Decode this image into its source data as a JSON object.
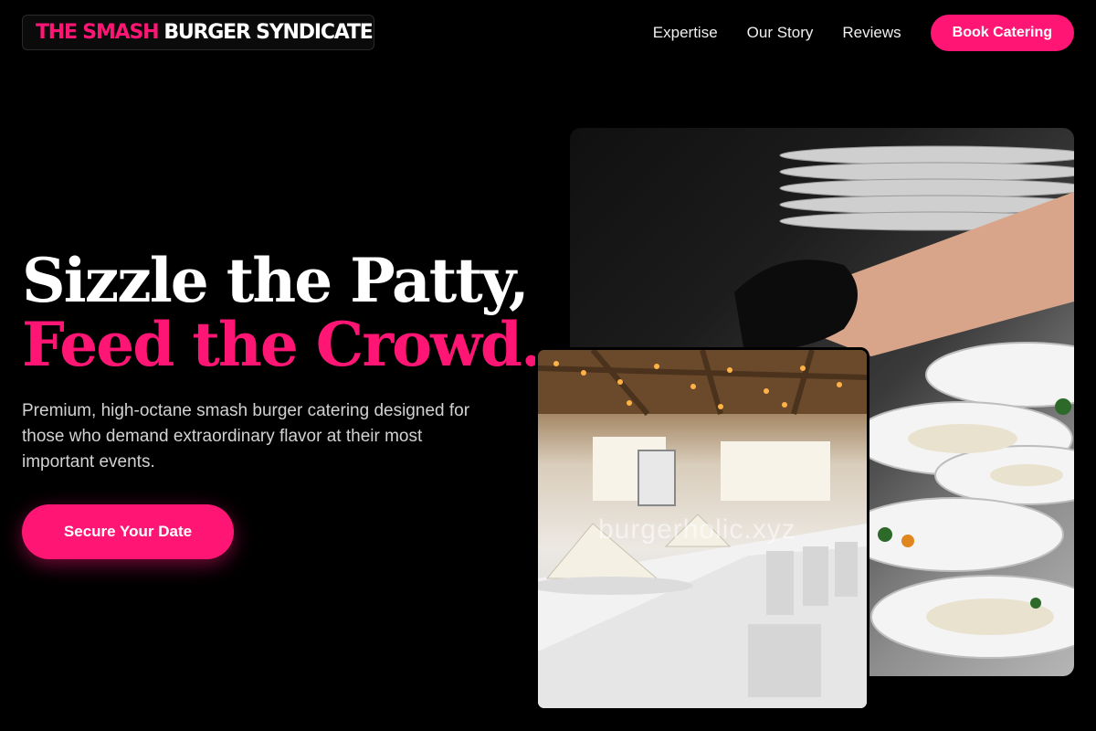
{
  "header": {
    "logo_accent": "THE SMASH",
    "logo_main": "BURGER SYNDICATE",
    "nav": [
      {
        "label": "Expertise"
      },
      {
        "label": "Our Story"
      },
      {
        "label": "Reviews"
      }
    ],
    "cta_label": "Book Catering"
  },
  "hero": {
    "headline_line1": "Sizzle the Patty,",
    "headline_line2": "Feed the Crowd.",
    "subtitle": "Premium, high-octane smash burger catering designed for those who demand extraordinary flavor at their most important events.",
    "cta_label": "Secure Your Date"
  },
  "images": {
    "back_alt": "Chef plating dishes",
    "front_alt": "Banquet table setting",
    "watermark": "burgerholic.xyz"
  },
  "colors": {
    "accent": "#ff1675",
    "background": "#000000"
  }
}
